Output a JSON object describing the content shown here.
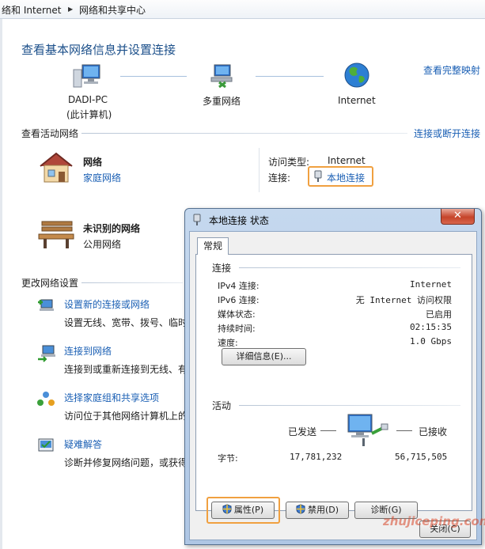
{
  "breadcrumb": {
    "item1": "络和 Internet",
    "item2": "网络和共享中心"
  },
  "page_title": "查看基本网络信息并设置连接",
  "view_full_map": "查看完整映射",
  "map_nodes": [
    {
      "name": "DADI-PC",
      "sub": "(此计算机)"
    },
    {
      "name": "多重网络"
    },
    {
      "name": "Internet"
    }
  ],
  "active_networks_title": "查看活动网络",
  "connect_disconnect": "连接或断开连接",
  "network1": {
    "name": "网络",
    "type": "家庭网络",
    "access_label": "访问类型:",
    "access_value": "Internet",
    "conn_label": "连接:",
    "conn_value": "本地连接"
  },
  "network2": {
    "name": "未识别的网络",
    "type": "公用网络"
  },
  "change_settings_title": "更改网络设置",
  "tasks": [
    {
      "title": "设置新的连接或网络",
      "desc": "设置无线、宽带、拨号、临时"
    },
    {
      "title": "连接到网络",
      "desc": "连接到或重新连接到无线、有"
    },
    {
      "title": "选择家庭组和共享选项",
      "desc": "访问位于其他网络计算机上的"
    },
    {
      "title": "疑难解答",
      "desc": "诊断并修复网络问题，或获得"
    }
  ],
  "dialog": {
    "title": "本地连接 状态",
    "close": "✕",
    "tab": "常规",
    "connection_group": "连接",
    "rows": [
      {
        "k": "IPv4 连接:",
        "v": "Internet"
      },
      {
        "k": "IPv6 连接:",
        "v": "无 Internet 访问权限"
      },
      {
        "k": "媒体状态:",
        "v": "已启用"
      },
      {
        "k": "持续时间:",
        "v": "02:15:35"
      },
      {
        "k": "速度:",
        "v": "1.0 Gbps"
      }
    ],
    "details_btn": "详细信息(E)...",
    "activity_group": "活动",
    "sent_label": "已发送",
    "recv_label": "已接收",
    "bytes_label": "字节:",
    "bytes_sent": "17,781,232",
    "bytes_recv": "56,715,505",
    "properties_btn": "属性(P)",
    "disable_btn": "禁用(D)",
    "diagnose_btn": "诊断(G)",
    "close_btn": "关闭(C)"
  },
  "watermark": "zhujiceping.com"
}
